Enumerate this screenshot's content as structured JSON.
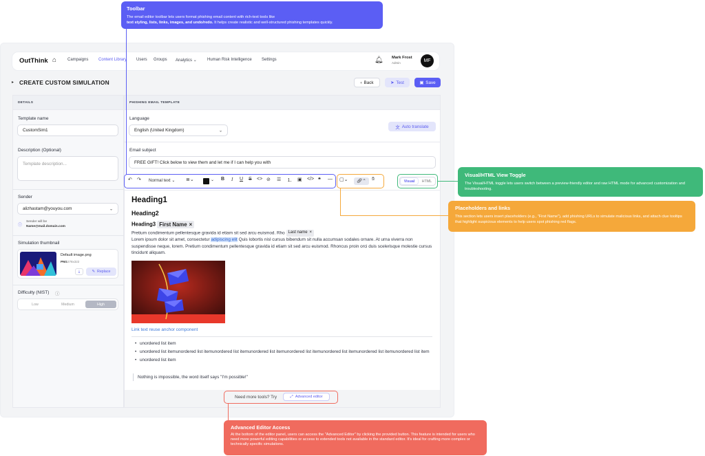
{
  "nav": {
    "logo": "OutThink",
    "items": [
      "Campaigns",
      "Content Library",
      "Users",
      "Groups",
      "Analytics",
      "Human Risk Intelligence",
      "Settings"
    ],
    "analytics_caret": "⌄",
    "user_name": "Mark Frost",
    "user_role": "Admin",
    "avatar_initials": "MF"
  },
  "page": {
    "title": "CREATE CUSTOM SIMULATION",
    "back_label": "Back",
    "test_label": "Test",
    "save_label": "Save"
  },
  "details": {
    "heading": "DETAILS",
    "template_name_label": "Template name",
    "template_name_value": "CustomSim1",
    "description_label": "Description (Optional)",
    "description_placeholder": "Template description...",
    "sender_label": "Sender",
    "sender_value": "alizhastam@youyou.com",
    "sender_note_line1": "Sender will be",
    "sender_note_line2": "Name@mail.domain.com",
    "thumbnail_label": "Simulation thumbnail",
    "thumbnail_file": "Default image.png",
    "thumbnail_type": "PNG",
    "thumbnail_dims": "278x322",
    "replace_label": "Replace",
    "difficulty_label": "Difficulty (NIST)",
    "difficulty_options": [
      "Low",
      "Medium",
      "High"
    ],
    "difficulty_selected": "High"
  },
  "template": {
    "heading": "PHISHING EMAIL TEMPLATE",
    "language_label": "Language",
    "language_value": "English (United Kingdom)",
    "auto_translate_label": "Auto translate",
    "subject_label": "Email subject",
    "subject_value": "FREE GIFT! Click below to view them and let me if I can help you with",
    "toolbar": {
      "text_style": "Normal text",
      "visual_label": "Visual",
      "html_label": "HTML"
    },
    "content": {
      "heading1": "Heading1",
      "heading2": "Heading2",
      "heading3": "Heading3",
      "first_name_chip": "First Name",
      "para1_a": "Pretium condimentum pellentesque gravida id etiam sit sed arcu euismod. Rho",
      "last_name_chip": "Last name",
      "para1_b": "Lorem ipsum dolor sit amet, consectetur",
      "para1_link": "adipiscing elit",
      "para1_c": "Quis lobortis nisl cursus bibendum sit nulla accumsan sodales ornare. At urna viverra non suspendisse neque, lorem. Pretium condimentum pellentesque gravida id etiam sit sed arcu euismod. Rhoncus proin orci duis scelerisque molestie cursus tincidunt aliquam.",
      "anchor_link": "Link text reuse anchor component",
      "bullets": [
        "unordered list item",
        "unordered list itemunordered list itemunordered list itemunordered list itemunordered list itemunordered list itemunordered list itemunordered list item",
        "unordered list item"
      ],
      "quote": "Nothing is impossible, the word itself says \"I'm possible!\""
    },
    "more_tools_text": "Need more tools? Try",
    "advanced_editor_label": "Advanced editor"
  },
  "annotations": {
    "toolbar": {
      "title": "Toolbar",
      "text_a": "The email editor toolbar lets users format phishing email content with rich-text tools like",
      "text_bold": "text styling, lists, links, images, and undo/redo.",
      "text_b": "It helps create realistic and well-structured phishing templates quickly.",
      "color": "#5b5ef4"
    },
    "visual_html": {
      "title": "Visual/HTML View Toggle",
      "text": "The Visual/HTML toggle lets users switch between a preview-friendly editor and raw HTML mode for advanced customization and troubleshooting.",
      "color": "#3fb97a"
    },
    "placeholders": {
      "title": "Placeholders and links",
      "text": "This section lets users insert placeholders (e.g., \"First Name\"), add phishing URLs to simulate malicious links, and attach clue tooltips that highlight suspicious elements to help users spot phishing red flags.",
      "color": "#f5a83a"
    },
    "advanced": {
      "title": "Advanced Editor Access",
      "text": "At the bottom of the editor panel, users can access the \"Advanced Editor\" by clicking the provided button. This feature is intended for users who need more powerful editing capabilities or access to extended tools not available in the standard editor. It's ideal for crafting more complex or technically specific simulations.",
      "color": "#f06b5e"
    }
  }
}
